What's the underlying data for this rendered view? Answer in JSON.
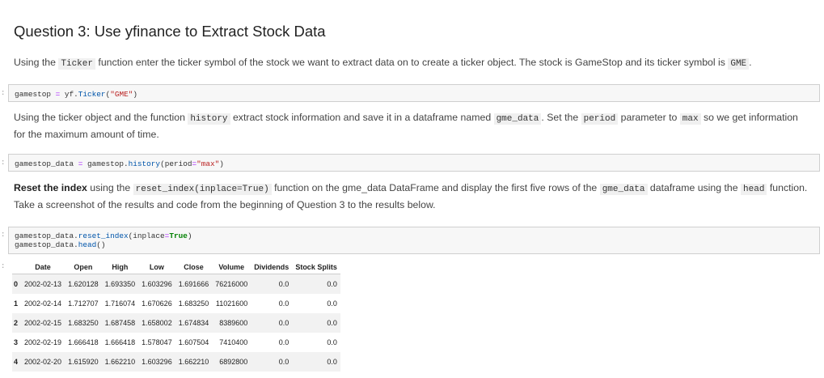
{
  "heading": "Question 3: Use yfinance to Extract Stock Data",
  "para1": {
    "t1": "Using the ",
    "c1": "Ticker",
    "t2": " function enter the ticker symbol of the stock we want to extract data on to create a ticker object. The stock is GameStop and its ticker symbol is ",
    "c2": "GME",
    "t3": "."
  },
  "cell1": {
    "prompt": ":",
    "code": {
      "a": "gamestop ",
      "op": "=",
      "b": " yf.",
      "fn": "Ticker",
      "c": "(",
      "s": "\"GME\"",
      "d": ")"
    }
  },
  "para2": {
    "t1": "Using the ticker object and the function ",
    "c1": "history",
    "t2": " extract stock information and save it in a dataframe named ",
    "c2": "gme_data",
    "t3": ". Set the ",
    "c3": "period",
    "t4": " parameter to ",
    "c4": "max",
    "t5": " so we get information for the maximum amount of time."
  },
  "cell2": {
    "prompt": ":",
    "code": {
      "a": "gamestop_data ",
      "op": "=",
      "b": " gamestop.",
      "fn": "history",
      "c": "(period",
      "op2": "=",
      "s": "\"max\"",
      "d": ")"
    }
  },
  "para3": {
    "bold": "Reset the index",
    "t1": " using the ",
    "c1": "reset_index(inplace=True)",
    "t2": " function on the gme_data DataFrame and display the first five rows of the ",
    "c2": "gme_data",
    "t3": " dataframe using the ",
    "c3": "head",
    "t4": " function. Take a screenshot of the results and code from the beginning of Question 3 to the results below."
  },
  "cell3": {
    "prompt": ":",
    "line1": {
      "a": "gamestop_data.",
      "fn": "reset_index",
      "b": "(inplace",
      "op": "=",
      "kw": "True",
      "c": ")"
    },
    "line2": {
      "a": "gamestop_data.",
      "fn": "head",
      "b": "()"
    }
  },
  "output_prompt": ":",
  "table": {
    "columns": [
      "",
      "Date",
      "Open",
      "High",
      "Low",
      "Close",
      "Volume",
      "Dividends",
      "Stock Splits"
    ],
    "rows": [
      [
        "0",
        "2002-02-13",
        "1.620128",
        "1.693350",
        "1.603296",
        "1.691666",
        "76216000",
        "0.0",
        "0.0"
      ],
      [
        "1",
        "2002-02-14",
        "1.712707",
        "1.716074",
        "1.670626",
        "1.683250",
        "11021600",
        "0.0",
        "0.0"
      ],
      [
        "2",
        "2002-02-15",
        "1.683250",
        "1.687458",
        "1.658002",
        "1.674834",
        "8389600",
        "0.0",
        "0.0"
      ],
      [
        "3",
        "2002-02-19",
        "1.666418",
        "1.666418",
        "1.578047",
        "1.607504",
        "7410400",
        "0.0",
        "0.0"
      ],
      [
        "4",
        "2002-02-20",
        "1.615920",
        "1.662210",
        "1.603296",
        "1.662210",
        "6892800",
        "0.0",
        "0.0"
      ]
    ]
  }
}
